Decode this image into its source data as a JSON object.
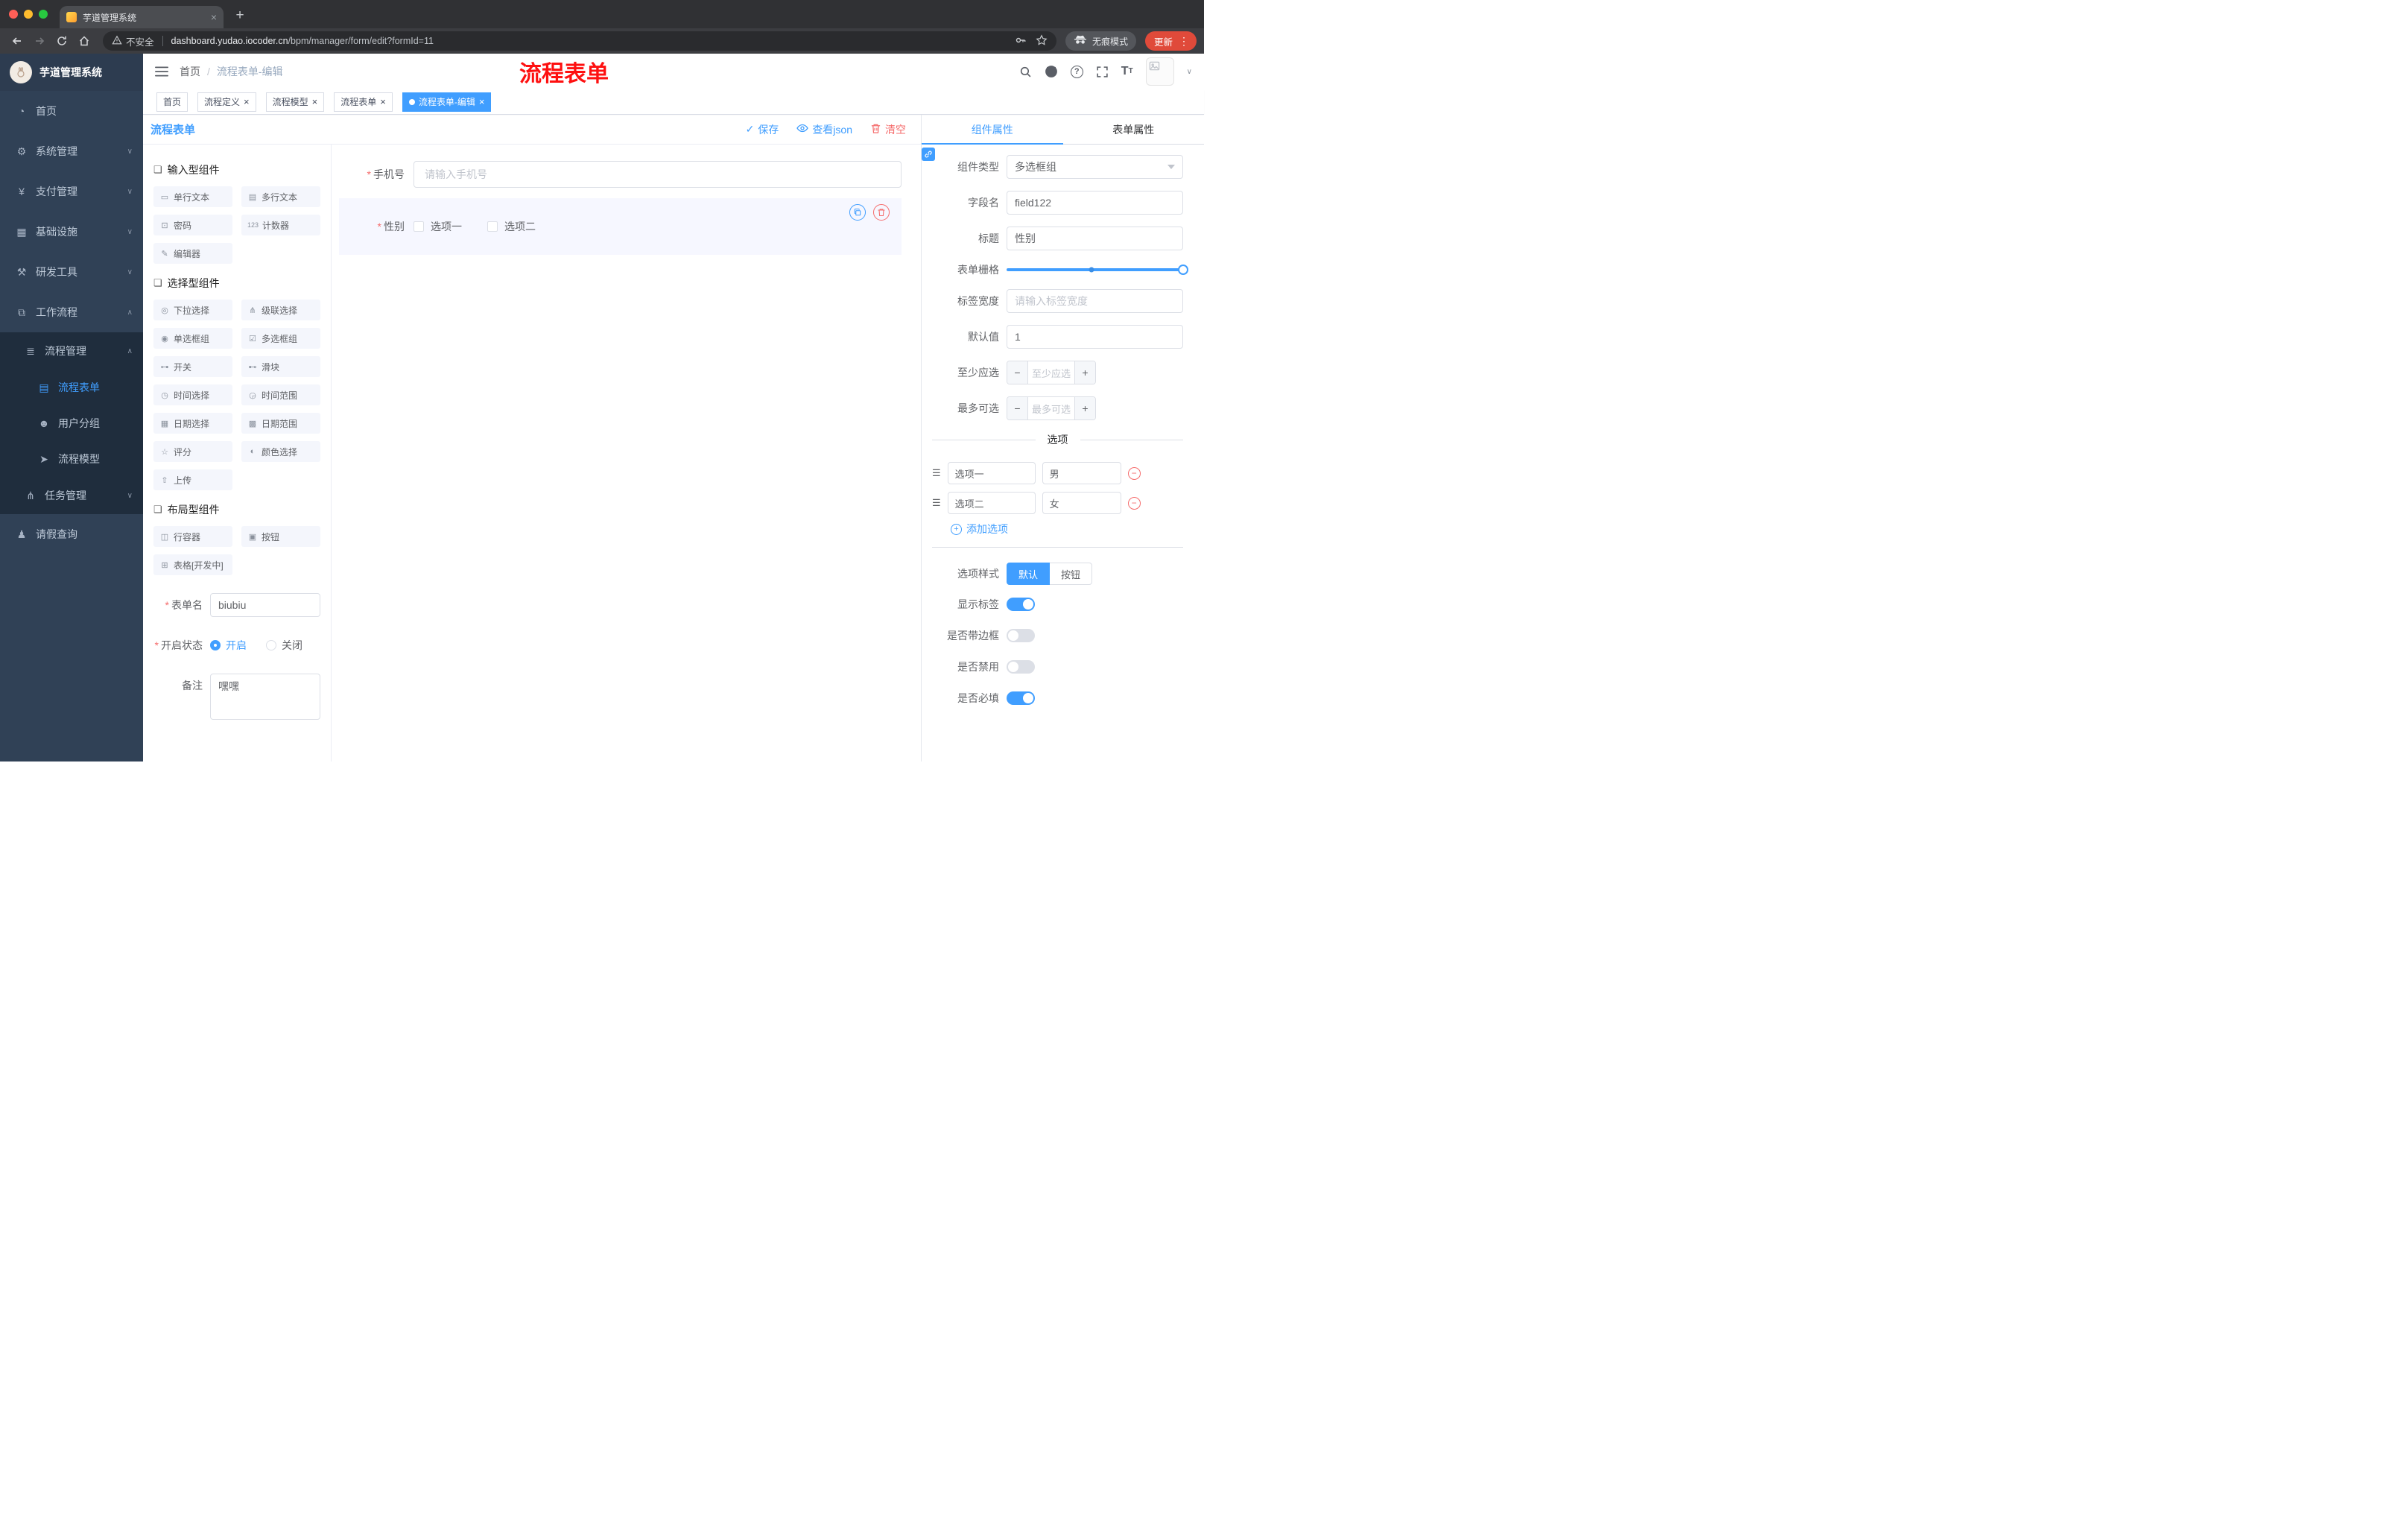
{
  "colors": {
    "accent": "#409EFF",
    "danger": "#F56C6C",
    "sidebar_bg": "#304156",
    "sidebar_submenu_bg": "#1f2d3d",
    "annotation_red": "#FE1010",
    "active_tag_bg": "#409EFF"
  },
  "glyphs": {
    "close": "×",
    "new_tab": "+",
    "kebab": "⋮",
    "chevron_down": "∨",
    "chevron_up": "∧",
    "check": "✓",
    "question": "?",
    "minus": "−",
    "plus": "+",
    "asterisk": "*",
    "drag": "☰",
    "section_bullet": "❏",
    "font_large": "T",
    "font_small": "T"
  },
  "browser": {
    "tab_title": "芋道管理系统",
    "security_label": "不安全",
    "url_domain": "dashboard.yudao.iocoder.cn",
    "url_path": "/bpm/manager/form/edit?formId=11",
    "incognito_label": "无痕模式",
    "update_label": "更新"
  },
  "sidebar": {
    "logo_title": "芋道管理系统",
    "items": [
      {
        "label": "首页",
        "icon": "◔"
      },
      {
        "label": "系统管理",
        "icon": "⚙"
      },
      {
        "label": "支付管理",
        "icon": "¥"
      },
      {
        "label": "基础设施",
        "icon": "▦"
      },
      {
        "label": "研发工具",
        "icon": "⚒"
      },
      {
        "label": "工作流程",
        "icon": "⧉"
      }
    ],
    "submenu": {
      "label": "流程管理",
      "icon": "≣",
      "children": [
        {
          "label": "流程表单",
          "icon": "▤",
          "active": true
        },
        {
          "label": "用户分组",
          "icon": "☻",
          "active": false
        },
        {
          "label": "流程模型",
          "icon": "➤",
          "active": false
        }
      ]
    },
    "task_item": {
      "label": "任务管理",
      "icon": "⋔"
    },
    "leave_item": {
      "label": "请假查询",
      "icon": "♟"
    }
  },
  "header": {
    "breadcrumb": {
      "home": "首页",
      "separator": "/",
      "current": "流程表单-编辑"
    },
    "annotation": "流程表单"
  },
  "tags": [
    {
      "label": "首页"
    },
    {
      "label": "流程定义"
    },
    {
      "label": "流程模型"
    },
    {
      "label": "流程表单"
    },
    {
      "label": "流程表单-编辑"
    }
  ],
  "designer": {
    "title": "流程表单",
    "actions": {
      "save": "保存",
      "view_json": "查看json",
      "clear": "清空"
    }
  },
  "palette": {
    "sections": [
      {
        "title": "输入型组件",
        "items": [
          {
            "label": "单行文本",
            "icon": "▭"
          },
          {
            "label": "多行文本",
            "icon": "▤"
          },
          {
            "label": "密码",
            "icon": "⊡"
          },
          {
            "label": "计数器",
            "icon": "123"
          },
          {
            "label": "编辑器",
            "icon": "✎"
          }
        ]
      },
      {
        "title": "选择型组件",
        "items": [
          {
            "label": "下拉选择",
            "icon": "◎"
          },
          {
            "label": "级联选择",
            "icon": "⋔"
          },
          {
            "label": "单选框组",
            "icon": "◉"
          },
          {
            "label": "多选框组",
            "icon": "☑"
          },
          {
            "label": "开关",
            "icon": "⊶"
          },
          {
            "label": "滑块",
            "icon": "⊷"
          },
          {
            "label": "时间选择",
            "icon": "◷"
          },
          {
            "label": "时间范围",
            "icon": "◶"
          },
          {
            "label": "日期选择",
            "icon": "▦"
          },
          {
            "label": "日期范围",
            "icon": "▩"
          },
          {
            "label": "评分",
            "icon": "☆"
          },
          {
            "label": "颜色选择",
            "icon": "◐"
          },
          {
            "label": "上传",
            "icon": "⇧"
          }
        ]
      },
      {
        "title": "布局型组件",
        "items": [
          {
            "label": "行容器",
            "icon": "◫"
          },
          {
            "label": "按钮",
            "icon": "▣"
          },
          {
            "label": "表格[开发中]",
            "icon": "⊞"
          }
        ]
      }
    ],
    "meta": {
      "form_name": {
        "label": "表单名",
        "value": "biubiu"
      },
      "status": {
        "label": "开启状态",
        "options": [
          {
            "label": "开启",
            "selected": true
          },
          {
            "label": "关闭",
            "selected": false
          }
        ]
      },
      "remark": {
        "label": "备注",
        "value": "嘿嘿"
      }
    }
  },
  "canvas": {
    "fields": [
      {
        "label": "手机号",
        "required": true,
        "placeholder": "请输入手机号"
      },
      {
        "label": "性别",
        "required": true,
        "options": [
          "选项一",
          "选项二"
        ],
        "selected": true
      }
    ]
  },
  "props": {
    "tabs": [
      {
        "label": "组件属性",
        "active": true
      },
      {
        "label": "表单属性",
        "active": false
      }
    ],
    "rows": {
      "component_type": {
        "label": "组件类型",
        "value": "多选框组"
      },
      "field_name": {
        "label": "字段名",
        "value": "field122"
      },
      "title": {
        "label": "标题",
        "value": "性别"
      },
      "grid": {
        "label": "表单栅格"
      },
      "label_width": {
        "label": "标签宽度",
        "placeholder": "请输入标签宽度"
      },
      "default_value": {
        "label": "默认值",
        "value": "1"
      },
      "min_select": {
        "label": "至少应选",
        "placeholder": "至少应选"
      },
      "max_select": {
        "label": "最多可选",
        "placeholder": "最多可选"
      }
    },
    "options_divider": "选项",
    "options": [
      {
        "name": "选项一",
        "value": "男"
      },
      {
        "name": "选项二",
        "value": "女"
      }
    ],
    "add_option": "添加选项",
    "option_style": {
      "label": "选项样式",
      "choices": [
        {
          "label": "默认",
          "active": true
        },
        {
          "label": "按钮",
          "active": false
        }
      ]
    },
    "switches": [
      {
        "label": "显示标签",
        "on": true
      },
      {
        "label": "是否带边框",
        "on": false
      },
      {
        "label": "是否禁用",
        "on": false
      },
      {
        "label": "是否必填",
        "on": true
      }
    ]
  }
}
